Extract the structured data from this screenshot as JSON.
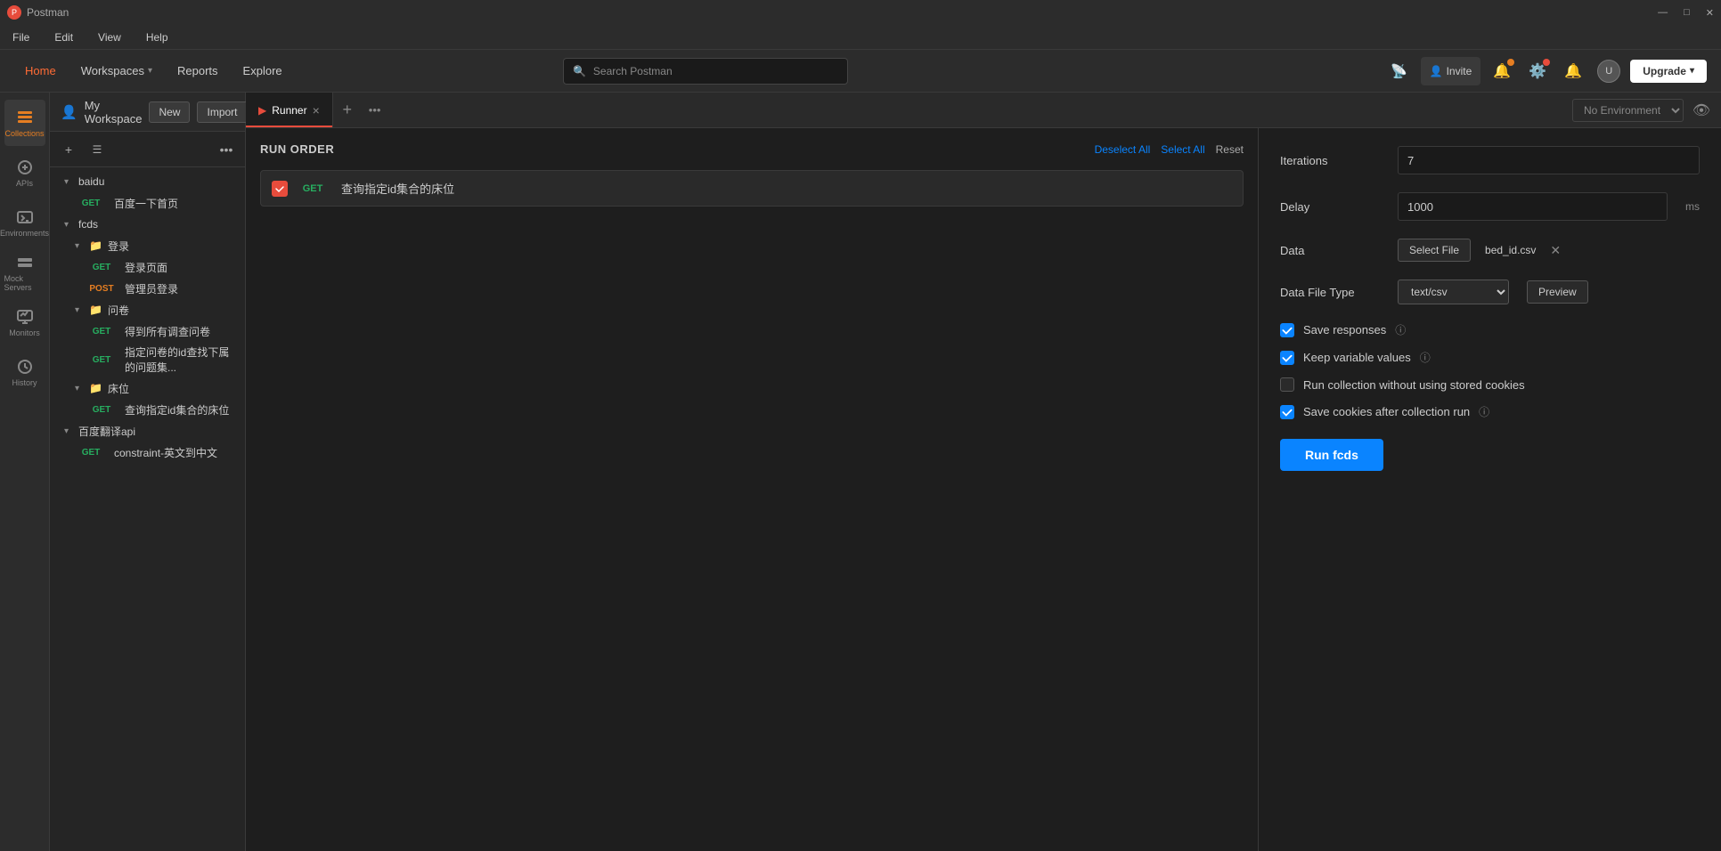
{
  "app": {
    "title": "Postman",
    "logo": "P"
  },
  "titlebar": {
    "app_name": "Postman",
    "minimize": "—",
    "maximize": "□",
    "close": "✕"
  },
  "menubar": {
    "items": [
      "File",
      "Edit",
      "View",
      "Help"
    ]
  },
  "topnav": {
    "home": "Home",
    "workspaces": "Workspaces",
    "reports": "Reports",
    "explore": "Explore",
    "search_placeholder": "Search Postman",
    "invite": "Invite",
    "upgrade": "Upgrade"
  },
  "workspace": {
    "title": "My Workspace",
    "new_btn": "New",
    "import_btn": "Import"
  },
  "sidebar": {
    "icons": [
      {
        "name": "collections",
        "label": "Collections",
        "icon": "collections"
      },
      {
        "name": "apis",
        "label": "APIs",
        "icon": "apis"
      },
      {
        "name": "environments",
        "label": "Environments",
        "icon": "environments"
      },
      {
        "name": "mock-servers",
        "label": "Mock Servers",
        "icon": "mock"
      },
      {
        "name": "monitors",
        "label": "Monitors",
        "icon": "monitors"
      },
      {
        "name": "history",
        "label": "History",
        "icon": "history"
      }
    ]
  },
  "tree": {
    "items": [
      {
        "id": "baidu",
        "level": 1,
        "type": "collection",
        "label": "baidu",
        "expanded": true
      },
      {
        "id": "baidu-get",
        "level": 2,
        "type": "request",
        "method": "GET",
        "label": "百度一下首页"
      },
      {
        "id": "fcds",
        "level": 1,
        "type": "collection",
        "label": "fcds",
        "expanded": true
      },
      {
        "id": "denglu-folder",
        "level": 2,
        "type": "folder",
        "label": "登录",
        "expanded": true
      },
      {
        "id": "denglu-get",
        "level": 3,
        "type": "request",
        "method": "GET",
        "label": "登录页面"
      },
      {
        "id": "denglu-post",
        "level": 3,
        "type": "request",
        "method": "POST",
        "label": "管理员登录"
      },
      {
        "id": "wenjuan-folder",
        "level": 2,
        "type": "folder",
        "label": "问卷",
        "expanded": true
      },
      {
        "id": "wenjuan-get1",
        "level": 3,
        "type": "request",
        "method": "GET",
        "label": "得到所有调查问卷"
      },
      {
        "id": "wenjuan-get2",
        "level": 3,
        "type": "request",
        "method": "GET",
        "label": "指定问卷的id查找下属的问题集..."
      },
      {
        "id": "chuwei-folder",
        "level": 2,
        "type": "folder",
        "label": "床位",
        "expanded": true
      },
      {
        "id": "chuwei-get",
        "level": 3,
        "type": "request",
        "method": "GET",
        "label": "查询指定id集合的床位"
      },
      {
        "id": "baidu-trans",
        "level": 1,
        "type": "collection",
        "label": "百度翻译api",
        "expanded": true
      },
      {
        "id": "trans-get",
        "level": 2,
        "type": "request",
        "method": "GET",
        "label": "constraint-英文到中文"
      }
    ]
  },
  "tab": {
    "icon": "▶",
    "label": "Runner",
    "close": "×",
    "add": "+",
    "more": "•••",
    "env": "No Environment"
  },
  "runner": {
    "title": "RUN ORDER",
    "deselect_all": "Deselect All",
    "select_all": "Select All",
    "reset": "Reset",
    "request": {
      "checked": true,
      "method": "GET",
      "label": "查询指定id集合的床位"
    }
  },
  "config": {
    "iterations_label": "Iterations",
    "iterations_value": "7",
    "delay_label": "Delay",
    "delay_value": "1000",
    "delay_suffix": "ms",
    "data_label": "Data",
    "select_file_btn": "Select File",
    "file_name": "bed_id.csv",
    "data_file_type_label": "Data File Type",
    "data_file_type_value": "text/csv",
    "preview_btn": "Preview",
    "checkboxes": [
      {
        "id": "save-responses",
        "label": "Save responses",
        "checked": true,
        "has_info": true
      },
      {
        "id": "keep-variable",
        "label": "Keep variable values",
        "checked": true,
        "has_info": true
      },
      {
        "id": "no-cookies",
        "label": "Run collection without using stored cookies",
        "checked": false,
        "has_info": false
      },
      {
        "id": "save-cookies",
        "label": "Save cookies after collection run",
        "checked": true,
        "has_info": true
      }
    ],
    "run_btn": "Run fcds"
  }
}
